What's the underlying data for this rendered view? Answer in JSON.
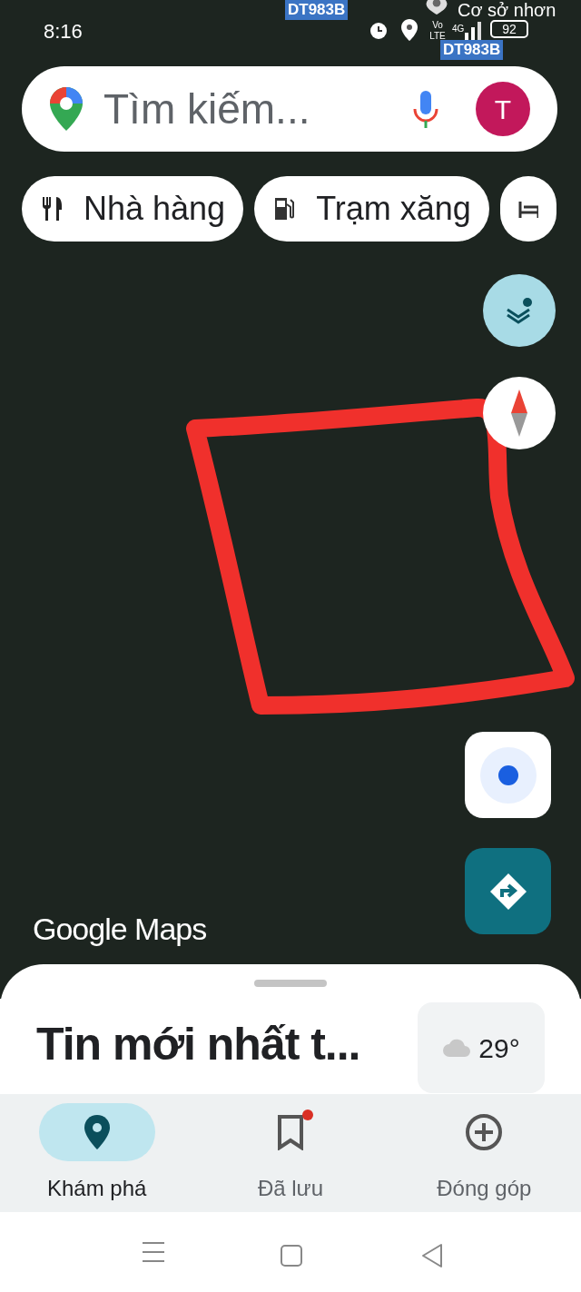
{
  "status_bar": {
    "time": "8:16",
    "network": "4G",
    "volte": "Vo LTE",
    "battery": "92"
  },
  "map": {
    "labels": [
      {
        "text": "DT983B"
      },
      {
        "text": "DT983B"
      }
    ],
    "place_label": "Cơ sở nhơn",
    "attribution": "Google Maps"
  },
  "search": {
    "placeholder": "Tìm kiếm...",
    "avatar": "T"
  },
  "chips": [
    {
      "kind": "restaurant",
      "label": "Nhà hàng"
    },
    {
      "kind": "gas",
      "label": "Trạm xăng"
    },
    {
      "kind": "hotel"
    }
  ],
  "sheet": {
    "title": "Tin mới nhất t...",
    "weather": "29°"
  },
  "nav": [
    {
      "kind": "explore",
      "label": "Khám phá",
      "selected": true,
      "badge": false
    },
    {
      "kind": "saved",
      "label": "Đã lưu",
      "selected": false,
      "badge": true
    },
    {
      "kind": "contribute",
      "label": "Đóng góp",
      "selected": false,
      "badge": false
    }
  ]
}
